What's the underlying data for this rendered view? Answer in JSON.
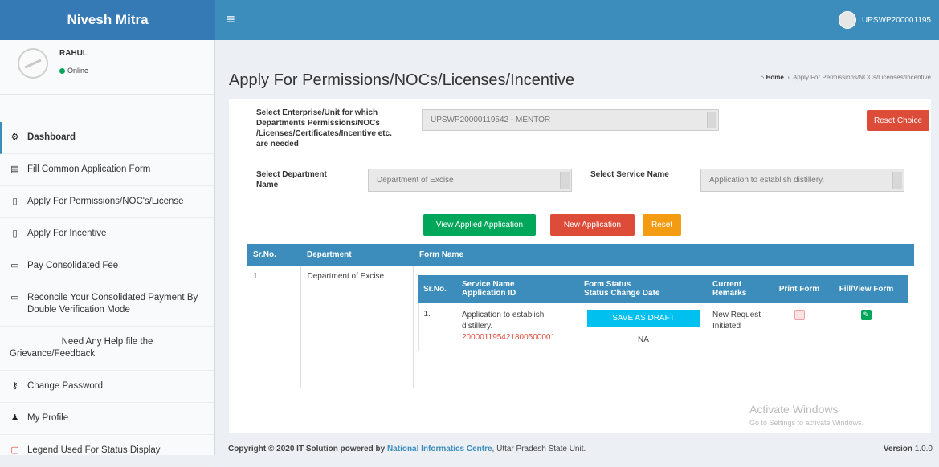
{
  "brand": "Nivesh Mitra",
  "topbar": {
    "username": "UPSWP200001195"
  },
  "user": {
    "name": "RAHUL",
    "status": "Online"
  },
  "sidebar": {
    "items": [
      {
        "label": "Dashboard",
        "icon": "dashboard-icon"
      },
      {
        "label": "Fill Common Application Form",
        "icon": "form-icon"
      },
      {
        "label": "Apply For Permissions/NOC's/License",
        "icon": "file-icon"
      },
      {
        "label": "Apply For Incentive",
        "icon": "file-icon"
      },
      {
        "label": "Pay Consolidated Fee",
        "icon": "credit-card-icon"
      },
      {
        "label": "Reconcile Your Consolidated Payment By Double Verification Mode",
        "icon": "credit-card-icon"
      },
      {
        "label1": "Need Any Help file the",
        "label2": "Grievance/Feedback"
      },
      {
        "label": "Change Password",
        "icon": "key-icon"
      },
      {
        "label": "My Profile",
        "icon": "user-icon"
      },
      {
        "label": "Legend Used For Status Display",
        "icon": "square-icon"
      }
    ]
  },
  "page": {
    "title": "Apply For Permissions/NOCs/Licenses/Incentive",
    "breadcrumb_home": "Home",
    "breadcrumb_current": "Apply For Permissions/NOCs/Licenses/Incentive"
  },
  "form": {
    "enterprise_label": "Select Enterprise/Unit for which Departments Permissions/NOCs /Licenses/Certificates/Incentive etc. are needed",
    "enterprise_value": "UPSWP20000119542 - MENTOR",
    "reset_choice": "Reset Choice",
    "dept_label": "Select Department Name",
    "dept_value": "Department of Excise",
    "service_label": "Select Service Name",
    "service_value": "Application to establish distillery."
  },
  "buttons": {
    "view_applied": "View Applied Application",
    "new_application": "New Application",
    "reset": "Reset"
  },
  "table": {
    "headers": [
      "Sr.No.",
      "Department",
      "Form Name"
    ],
    "row": {
      "srno": "1.",
      "department": "Department of Excise"
    },
    "inner_headers": {
      "srno": "Sr.No.",
      "service_name": "Service Name",
      "application_id": "Application ID",
      "form_status": "Form Status",
      "status_change_date": "Status Change Date",
      "current": "Current",
      "remarks": "Remarks",
      "print_form": "Print Form",
      "fill_view": "Fill/View Form"
    },
    "inner_row": {
      "srno": "1.",
      "service": "Application to establish distillery.",
      "app_id": "200001195421800500001",
      "status": "SAVE AS DRAFT",
      "date": "NA",
      "remarks": "New Request Initiated"
    }
  },
  "footer": {
    "copyright": "Copyright © 2020 IT Solution powered by",
    "link": "National Informatics Centre",
    "unit": ", Uttar Pradesh State Unit.",
    "version_label": "Version",
    "version": "1.0.0"
  },
  "watermark": {
    "line1": "Activate Windows",
    "line2": "Go to Settings to activate Windows."
  },
  "colors": {
    "brand": "#3579b5",
    "navbar": "#3c8dbc",
    "green": "#00a65a",
    "red": "#dd4b39",
    "orange": "#f39c12",
    "draft": "#00c0ef"
  }
}
